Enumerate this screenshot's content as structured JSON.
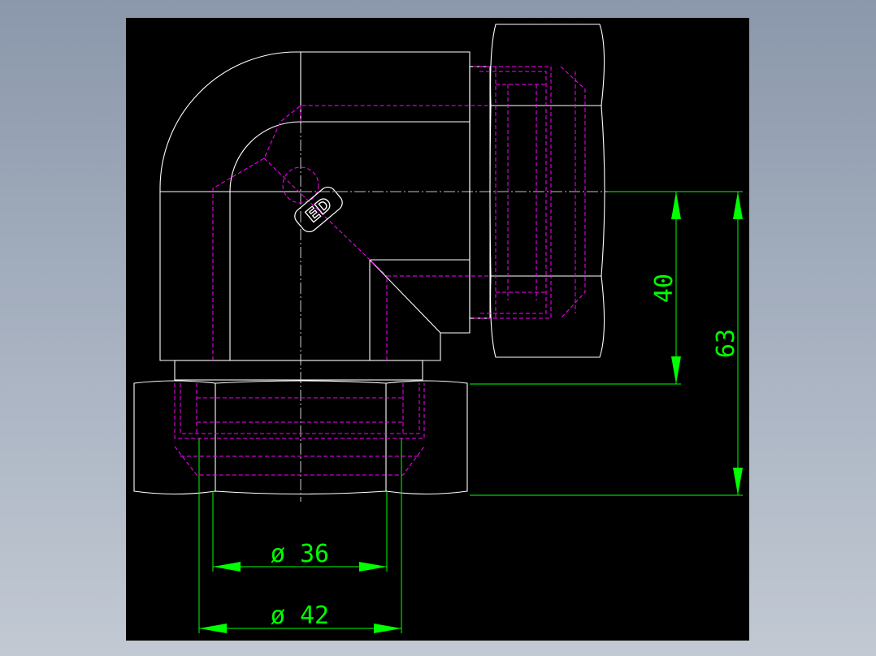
{
  "drawing": {
    "dimensions": {
      "height_inner": "40",
      "height_outer": "63",
      "dia_inner": "ø 36",
      "dia_outer": "ø 42"
    },
    "logo": "ED"
  },
  "colors": {
    "background": "#000000",
    "outline": "#ffffff",
    "hidden_lines": "#ff00ff",
    "dimensions": "#00ff00",
    "window_bg": "#9aa5b5"
  }
}
